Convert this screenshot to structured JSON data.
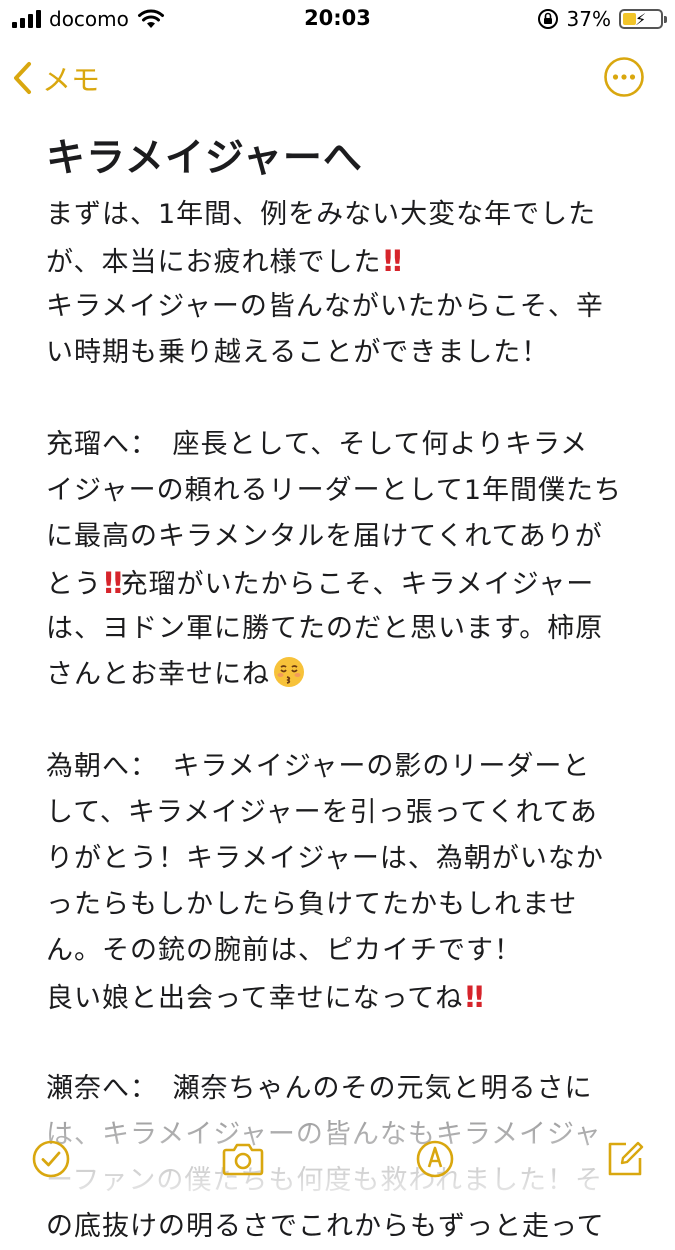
{
  "status_bar": {
    "carrier": "docomo",
    "time": "20:03",
    "battery_percent": "37%",
    "battery_level": 0.37,
    "icons": [
      "signal-bars-icon",
      "wifi-icon",
      "orientation-lock-icon",
      "battery-charging-icon"
    ]
  },
  "nav": {
    "back_label": "メモ",
    "back_icon": "chevron-left-icon",
    "more_icon": "ellipsis-circle-icon",
    "accent_color": "#d9a70f"
  },
  "note": {
    "title": "キラメイジャーへ",
    "lines": [
      "まずは、1年間、例をみない大変な年でした",
      "が、本当にお疲れ様でした‼️",
      "キラメイジャーの皆んながいたからこそ、辛",
      "い時期も乗り越えることができました！",
      "",
      "充瑠へ：　座長として、そして何よりキラメ",
      "イジャーの頼れるリーダーとして1年間僕たち",
      "に最高のキラメンタルを届けてくれてありが",
      "とう‼️充瑠がいたからこそ、キラメイジャー",
      "は、ヨドン軍に勝てたのだと思います。柿原",
      "さんとお幸せにね😚",
      "",
      "為朝へ：　キラメイジャーの影のリーダーと",
      "して、キラメイジャーを引っ張ってくれてあ",
      "りがとう！キラメイジャーは、為朝がいなか",
      "ったらもしかしたら負けてたかもしれませ",
      "ん。その銃の腕前は、ピカイチです！",
      "良い娘と出会って幸せになってね‼️",
      "",
      "瀬奈へ：　瀬奈ちゃんのその元気と明るさに",
      "は、キラメイジャーの皆んなもキラメイジャ",
      "ーファンの僕たちも何度も救われました！そ",
      "の底抜けの明るさでこれからもずっと走って"
    ]
  },
  "toolbar": {
    "items": [
      "checklist-icon",
      "camera-icon",
      "markup-pen-icon",
      "compose-icon"
    ],
    "accent_color": "#d9a70f"
  }
}
